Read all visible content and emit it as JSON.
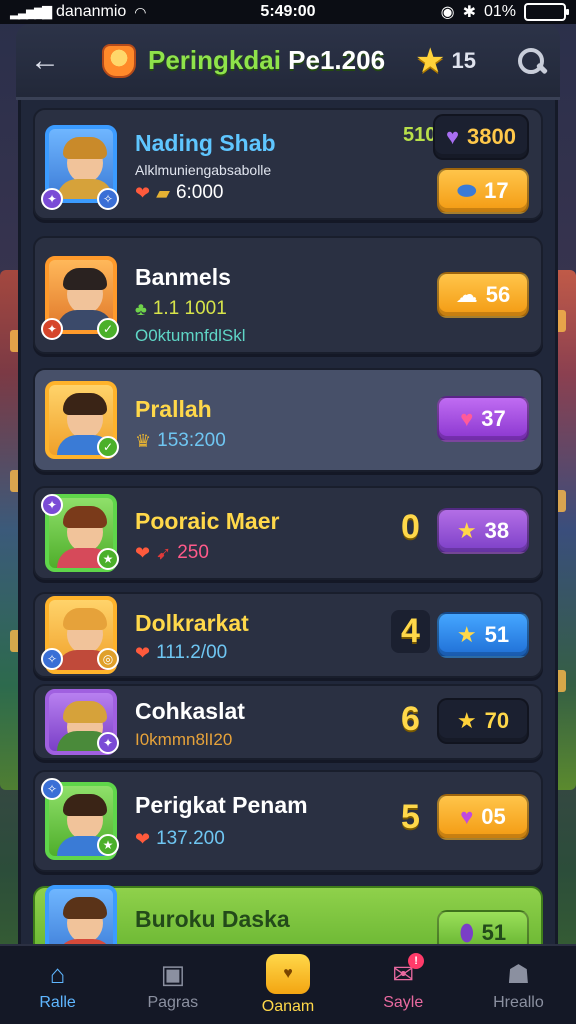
{
  "status_bar": {
    "carrier": "dananmio",
    "time": "5:49:00",
    "battery": "01%"
  },
  "header": {
    "title": "Peringkdai",
    "title_suffix": "Pe1.206",
    "stars": "15"
  },
  "rows": [
    {
      "name": "Nading Shab",
      "line2": "Alklmuniengabsabolle",
      "score": "6:000",
      "points": "510",
      "reward_top": "3800",
      "reward": "17",
      "reward_style": "orange"
    },
    {
      "name": "Banmels",
      "score": "1.1 1001",
      "line3": "O0ktumnfdlSkl",
      "reward": "56",
      "reward_style": "orange"
    },
    {
      "name": "Prallah",
      "score": "153:200",
      "reward": "37",
      "reward_style": "purple"
    },
    {
      "name": "Pooraic Maer",
      "score": "250",
      "rank": "0",
      "reward": "38",
      "reward_style": "lilac"
    },
    {
      "name": "Dolkrarkat",
      "score": "111.2/00",
      "rank": "4",
      "reward": "51",
      "reward_style": "blue"
    },
    {
      "name": "Cohkaslat",
      "score": "I0kmmn8lI20",
      "rank": "6",
      "reward": "70",
      "reward_style": "dark"
    },
    {
      "name": "Perigkat Penam",
      "score": "137.200",
      "rank": "5",
      "reward": "05",
      "reward_style": "orange"
    },
    {
      "name": "Buroku Daska",
      "reward": "51"
    }
  ],
  "nav": [
    {
      "label": "Ralle",
      "icon": "home-icon"
    },
    {
      "label": "Pagras",
      "icon": "profile-card-icon"
    },
    {
      "label": "Oanam",
      "icon": "heart-icon"
    },
    {
      "label": "Sayle",
      "icon": "mail-icon"
    },
    {
      "label": "Hreallo",
      "icon": "person-icon"
    }
  ],
  "colors": {
    "accent_green": "#8fe34b",
    "gold": "#ffd84a",
    "panel": "#20273a"
  }
}
